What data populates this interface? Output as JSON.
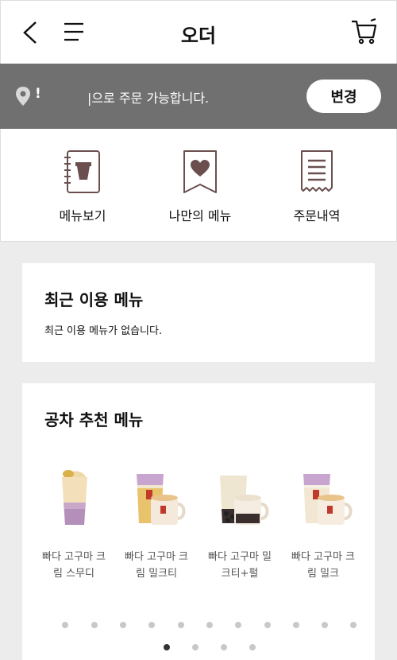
{
  "header": {
    "title": "오더"
  },
  "store_bar": {
    "excl": "!",
    "message": "|으로 주문 가능합니다.",
    "change_label": "변경"
  },
  "quick_menu": {
    "items": [
      {
        "label": "메뉴보기",
        "icon": "menu-book-icon"
      },
      {
        "label": "나만의 메뉴",
        "icon": "heart-bookmark-icon"
      },
      {
        "label": "주문내역",
        "icon": "receipt-icon"
      }
    ]
  },
  "recent": {
    "title": "최근 이용 메뉴",
    "empty_message": "최근 이용 메뉴가 없습니다."
  },
  "recommend": {
    "title": "공차 추천 메뉴",
    "products": [
      {
        "line1": "빠다 고구마 크",
        "line2": "림 스무디"
      },
      {
        "line1": "빠다 고구마 크",
        "line2": "림 밀크티"
      },
      {
        "line1": "빠다 고구마 밀",
        "line2": "크티+펄"
      },
      {
        "line1": "빠다 고구마 크",
        "line2": "림 밀크"
      }
    ],
    "carousel_page": 1,
    "carousel_pages": 4
  },
  "colors": {
    "brand_brown": "#6b4f4f",
    "store_bar_bg": "#707070",
    "page_bg": "#ececec"
  }
}
